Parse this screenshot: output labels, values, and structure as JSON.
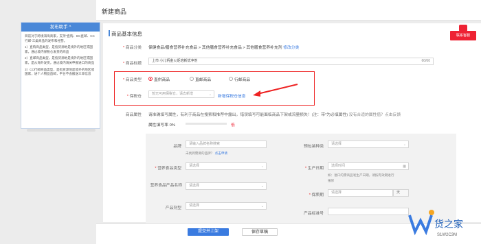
{
  "header": {
    "title": "新建商品"
  },
  "helper": {
    "title": "发布助手 ^",
    "paragraphs": [
      "目前对于跨境海淘商家，支持“直购、BC直邮、CC行邮”三类商品的发布和经营。",
      "1）直购商品类型，是指货源地是境外的地区或国家，通过境内保税仓发货的商品",
      "2）直邮商品类型，是指货源地是境外的地区或国家，是从海外发货，通过境内海关申报进口的商品",
      "3）CC行邮商品类型，是指货源地是境外的地区或国家，进个人物品直邮，平台不会搬送三单信息"
    ]
  },
  "section": {
    "title": "商品基本信息"
  },
  "form": {
    "category": {
      "label": "商品分类",
      "value": "保健食品/膳食营养补充食品 > 其他膳食营养补充食品 > 其他膳食营养补充剂",
      "action": "修改分类"
    },
    "product_title": {
      "label": "商品标题",
      "value": "上市                  小儿钙金火炬培新优冲剂",
      "count": "60/60"
    },
    "product_type": {
      "label": "商品类型",
      "options": [
        "直供商品",
        "直邮商品",
        "行邮商品"
      ]
    },
    "warehouse": {
      "label": "保税仓",
      "placeholder": "暂无可用保税仓，请去新增",
      "action": "新增保税仓信息"
    },
    "attributes": {
      "label": "商品属性",
      "note": "请准确填写属性，有利于商品在搜索和推荐中露出，错误填写可能面临商品下架或流量损失！(注：带*为必填属性)",
      "hint": "没有合适的属性值？点击反馈",
      "fill_label": "属性填写率 0%",
      "fill_value": "低",
      "fill_percent": 0
    }
  },
  "attrs": {
    "brand": {
      "label": "品牌",
      "placeholder": "请输入品牌名称搜索",
      "hint": "未找到需要的品牌？",
      "hint_link": "点击申请"
    },
    "nutrition_type": {
      "label": "营养食品类型",
      "placeholder": "请选择"
    },
    "nutrition_name": {
      "label": "营养食品产品名称",
      "placeholder": "请选择"
    },
    "dosage": {
      "label": "产品剂型",
      "placeholder": "请选择"
    },
    "presale": {
      "label": "预包装种类",
      "placeholder": "请选择"
    },
    "production_date": {
      "label": "生产日期",
      "placeholder": "选择时间",
      "hint": "如：进口的需商品发生产日期，请按有效期进行"
    },
    "hint2": "报修",
    "shelf_life": {
      "label": "保质期",
      "placeholder": "请选择",
      "unit": "天"
    },
    "standard": {
      "label": "产品标准号",
      "placeholder": ""
    }
  },
  "footer": {
    "submit": "提交并上架",
    "save": "保存草稿"
  },
  "float": {
    "label": "联系客服"
  },
  "watermark": {
    "text": "货之家",
    "sub": "S1W2C3M"
  }
}
